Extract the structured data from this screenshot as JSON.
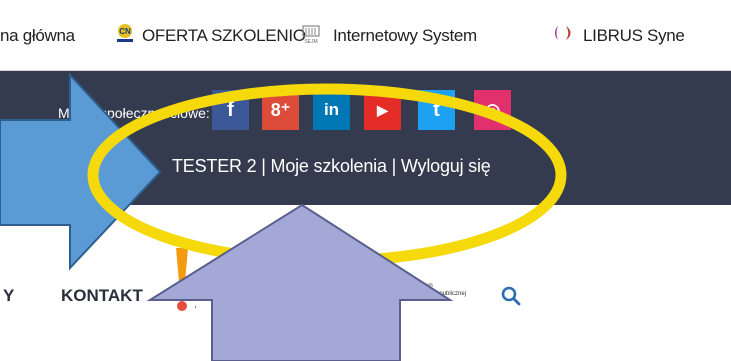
{
  "bookmarks": {
    "items": [
      {
        "label": "na główna",
        "icon": "home-partial"
      },
      {
        "label": "OFERTA SZKOLENIO",
        "icon": "cn-logo-icon"
      },
      {
        "label": "Internetowy System",
        "icon": "sejm-building-icon"
      },
      {
        "label": "LIBRUS Syne",
        "icon": "librus-logo-icon"
      }
    ]
  },
  "header": {
    "social_label": "Media społecznościowe:",
    "social_icons": [
      {
        "name": "facebook-icon",
        "glyph": "f",
        "color": "#3b5998"
      },
      {
        "name": "google-plus-icon",
        "glyph": "8⁺",
        "color": "#dd4b39"
      },
      {
        "name": "linkedin-icon",
        "glyph": "in",
        "color": "#0077b5"
      },
      {
        "name": "youtube-icon",
        "glyph": "▶",
        "color": "#e52d27"
      },
      {
        "name": "twitter-icon",
        "glyph": "t",
        "color": "#1da1f2"
      },
      {
        "name": "instagram-icon",
        "glyph": "◎",
        "color": "#e1306c"
      }
    ],
    "user_menu": {
      "user": "TESTER 2",
      "separator": "|",
      "my_trainings": "Moje szkolenia",
      "logout": "Wyloguj się"
    }
  },
  "nav": {
    "partial_item": "Y",
    "contact": "KONTAKT"
  },
  "bip": {
    "logo_text": "bip",
    "line1": "biuletyn",
    "line2": "informacji publicznej"
  },
  "colors": {
    "header_bg": "#343b4f",
    "highlight_ellipse": "#f5d90a",
    "arrow_blue": "#5b9bd5",
    "arrow_lavender": "#a3a8d6"
  }
}
